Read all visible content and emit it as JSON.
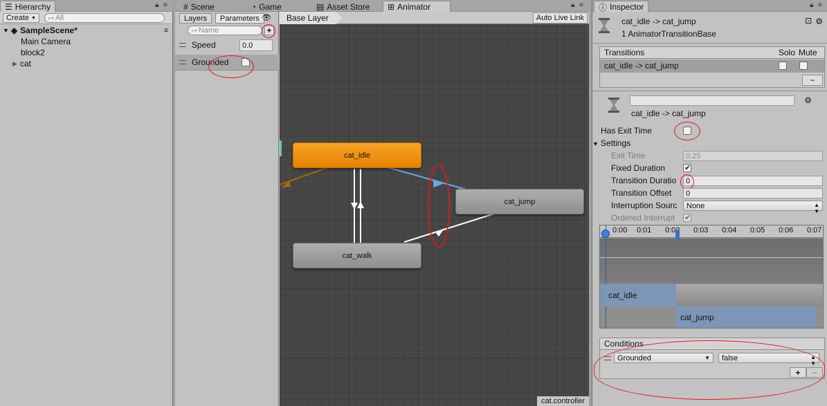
{
  "hierarchy": {
    "tab_label": "Hierarchy",
    "create_label": "Create",
    "search_placeholder": "All",
    "scene_name": "SampleScene*",
    "items": [
      "Main Camera",
      "block2",
      "cat"
    ]
  },
  "center_tabs": [
    "Scene",
    "Game",
    "Asset Store",
    "Animator"
  ],
  "animator": {
    "subtabs": [
      "Layers",
      "Parameters"
    ],
    "search_placeholder": "Name",
    "add_symbol": "+",
    "parameters": [
      {
        "name": "Speed",
        "value": "0.0"
      },
      {
        "name": "Grounded",
        "value": ""
      }
    ],
    "breadcrumb": "Base Layer",
    "auto_live_link": "Auto Live Link",
    "states": {
      "idle": "cat_idle",
      "jump": "cat_jump",
      "walk": "cat_walk"
    },
    "controller_name": "cat.controller"
  },
  "inspector": {
    "tab_label": "Inspector",
    "title": "cat_idle -> cat_jump",
    "subtitle": "1 AnimatorTransitionBase",
    "transitions_header": "Transitions",
    "solo_label": "Solo",
    "mute_label": "Mute",
    "transition_row": "cat_idle -> cat_jump",
    "remove_symbol": "−",
    "transition_name": "cat_idle -> cat_jump",
    "has_exit_time_label": "Has Exit Time",
    "settings_label": "Settings",
    "settings": {
      "exit_time_label": "Exit Time",
      "exit_time_value": "0.25",
      "fixed_duration_label": "Fixed Duration",
      "transition_duration_label": "Transition Duratio",
      "transition_duration_value": "0",
      "transition_offset_label": "Transition Offset",
      "transition_offset_value": "0",
      "interruption_source_label": "Interruption Sourc",
      "interruption_source_value": "None",
      "ordered_interrupt_label": "Ordered Interrupt"
    },
    "timeline": {
      "ticks": [
        "0:00",
        "0:01",
        "0:02",
        "0:03",
        "0:04",
        "0:05",
        "0:06",
        "0:07"
      ],
      "track_from": "cat_idle",
      "track_to": "cat_jump"
    },
    "conditions": {
      "header": "Conditions",
      "parameter": "Grounded",
      "value": "false",
      "add_symbol": "+",
      "remove_symbol": "−"
    }
  }
}
